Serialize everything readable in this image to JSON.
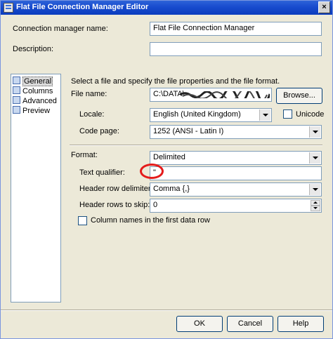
{
  "window": {
    "title": "Flat File Connection Manager Editor",
    "close_glyph": "×"
  },
  "header": {
    "connection_name_label": "Connection manager name:",
    "connection_name_value": "Flat File Connection Manager",
    "description_label": "Description:",
    "description_value": ""
  },
  "sidebar": {
    "items": [
      {
        "label": "General",
        "icon": "general-page-icon",
        "selected": true
      },
      {
        "label": "Columns",
        "icon": "columns-page-icon",
        "selected": false
      },
      {
        "label": "Advanced",
        "icon": "advanced-page-icon",
        "selected": false
      },
      {
        "label": "Preview",
        "icon": "preview-page-icon",
        "selected": false
      }
    ]
  },
  "general": {
    "instructions": "Select a file and specify the file properties and the file format.",
    "file_name_label": "File name:",
    "file_name_value": "C:\\DATA\\",
    "browse_label": "Browse...",
    "locale_label": "Locale:",
    "locale_value": "English (United Kingdom)",
    "unicode_label": "Unicode",
    "code_page_label": "Code page:",
    "code_page_value": "1252  (ANSI - Latin I)",
    "format_label": "Format:",
    "format_value": "Delimited",
    "text_qualifier_label": "Text qualifier:",
    "text_qualifier_value": "\"",
    "header_row_delimiter_label": "Header row delimiter:",
    "header_row_delimiter_value": "Comma {,}",
    "header_rows_skip_label": "Header rows to skip:",
    "header_rows_skip_value": "0",
    "column_names_label": "Column names in the first data row"
  },
  "footer": {
    "ok_label": "OK",
    "cancel_label": "Cancel",
    "help_label": "Help"
  },
  "colors": {
    "annotation_circle": "#e41b1b",
    "titlebar": "#0a3cbe"
  }
}
